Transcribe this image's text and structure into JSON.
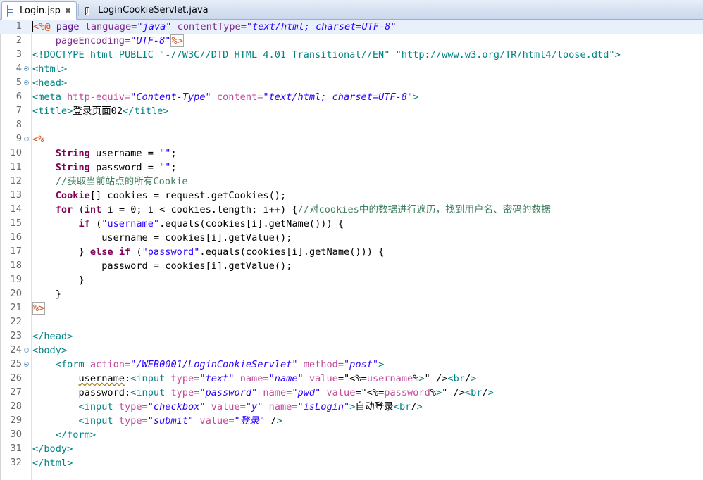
{
  "window": {
    "title": "Login.jsp - Eclipse IDE editor"
  },
  "tabs": [
    {
      "label": "Login.jsp",
      "icon": "jsp-file-icon",
      "active": true,
      "close_glyph": "✖"
    },
    {
      "label": "LoginCookieServlet.java",
      "icon": "java-file-icon",
      "active": false,
      "close_glyph": ""
    }
  ],
  "editor": {
    "language": "jsp",
    "current_line": 1,
    "cursor": {
      "line": 1,
      "column": 1
    },
    "total_lines": 32,
    "folded_lines": [
      4,
      5,
      9,
      24,
      25
    ],
    "spellcheck_words": [
      "username"
    ],
    "colors": {
      "background": "#ffffff",
      "current_line_highlight": "#e8f0fb",
      "line_number": "#6a6a6a",
      "html_tag": "#008484",
      "html_attribute": "#c3489a",
      "attribute_value": "#2a00ff",
      "jsp_delimiter": "#d1551f",
      "jsp_directive": "#5f0f8f",
      "java_keyword": "#7f0055",
      "java_string": "#2a00ff",
      "java_comment": "#3f7f5f",
      "plain_text": "#000000"
    },
    "lines": [
      {
        "n": 1,
        "text": "<%@ page language=\"java\" contentType=\"text/html; charset=UTF-8\""
      },
      {
        "n": 2,
        "text": "    pageEncoding=\"UTF-8\"%>"
      },
      {
        "n": 3,
        "text": "<!DOCTYPE html PUBLIC \"-//W3C//DTD HTML 4.01 Transitional//EN\" \"http://www.w3.org/TR/html4/loose.dtd\">"
      },
      {
        "n": 4,
        "text": "<html>"
      },
      {
        "n": 5,
        "text": "<head>"
      },
      {
        "n": 6,
        "text": "<meta http-equiv=\"Content-Type\" content=\"text/html; charset=UTF-8\">"
      },
      {
        "n": 7,
        "text": "<title>登录页面02</title>"
      },
      {
        "n": 8,
        "text": ""
      },
      {
        "n": 9,
        "text": "<%"
      },
      {
        "n": 10,
        "text": "    String username = \"\";"
      },
      {
        "n": 11,
        "text": "    String password = \"\";"
      },
      {
        "n": 12,
        "text": "    //获取当前站点的所有Cookie"
      },
      {
        "n": 13,
        "text": "    Cookie[] cookies = request.getCookies();"
      },
      {
        "n": 14,
        "text": "    for (int i = 0; i < cookies.length; i++) {//对cookies中的数据进行遍历，找到用户名、密码的数据"
      },
      {
        "n": 15,
        "text": "        if (\"username\".equals(cookies[i].getName())) {"
      },
      {
        "n": 16,
        "text": "            username = cookies[i].getValue();"
      },
      {
        "n": 17,
        "text": "        } else if (\"password\".equals(cookies[i].getName())) {"
      },
      {
        "n": 18,
        "text": "            password = cookies[i].getValue();"
      },
      {
        "n": 19,
        "text": "        }"
      },
      {
        "n": 20,
        "text": "    }"
      },
      {
        "n": 21,
        "text": "%>"
      },
      {
        "n": 22,
        "text": ""
      },
      {
        "n": 23,
        "text": "</head>"
      },
      {
        "n": 24,
        "text": "<body>"
      },
      {
        "n": 25,
        "text": "    <form action=\"/WEB0001/LoginCookieServlet\" method=\"post\">"
      },
      {
        "n": 26,
        "text": "        username:<input type=\"text\" name=\"name\" value=\"<%=username%>\" /><br/>"
      },
      {
        "n": 27,
        "text": "        password:<input type=\"password\" name=\"pwd\" value=\"<%=password%>\" /><br/>"
      },
      {
        "n": 28,
        "text": "        <input type=\"checkbox\" value=\"y\" name=\"isLogin\">自动登录<br/>"
      },
      {
        "n": 29,
        "text": "        <input type=\"submit\" value=\"登录\" />"
      },
      {
        "n": 30,
        "text": "    </form>"
      },
      {
        "n": 31,
        "text": "</body>"
      },
      {
        "n": 32,
        "text": "</html>"
      }
    ]
  }
}
